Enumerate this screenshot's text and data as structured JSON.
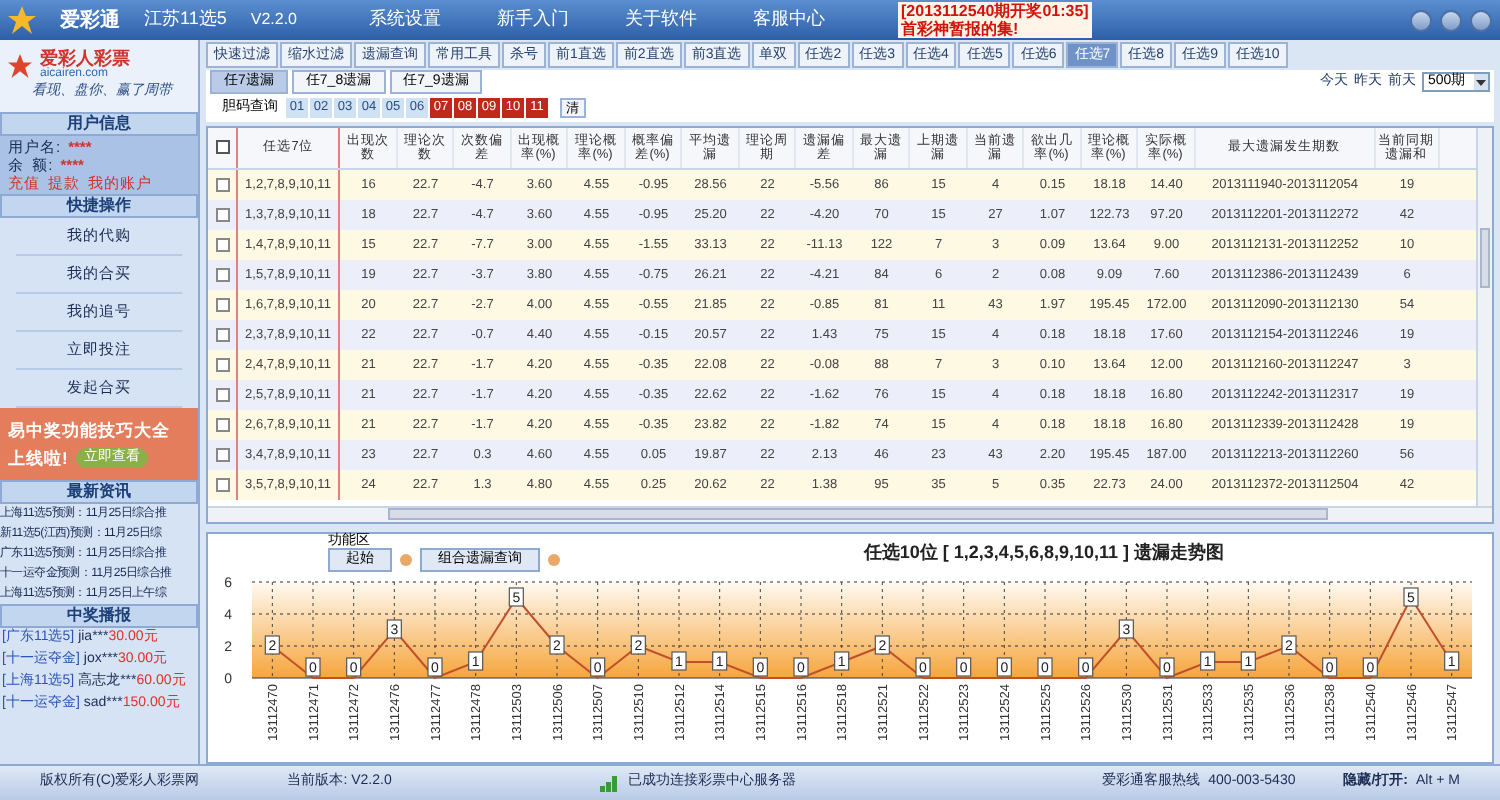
{
  "title_bar": {
    "app_name": "爱彩通",
    "lottery": "江苏11选5",
    "version": "V2.2.0",
    "menu": [
      "系统设置",
      "新手入门",
      "关于软件",
      "客服中心"
    ],
    "notice": [
      "[2013112540期开奖01:35]",
      "首彩神暂报的集!"
    ]
  },
  "sidebar": {
    "logo": {
      "name": "爱彩人彩票",
      "site": "aicairen.com",
      "slogan": "看现、盘你、赢了周带"
    },
    "user": {
      "header": "用户信息",
      "fields": [
        {
          "label": "用户名:",
          "value": "****"
        },
        {
          "label": "余  额:",
          "value": "****"
        }
      ],
      "links": [
        "充值",
        "提款",
        "我的账户"
      ]
    },
    "quick": {
      "header": "快捷操作",
      "items": [
        "我的代购",
        "我的合买",
        "我的追号",
        "立即投注",
        "发起合买"
      ]
    },
    "ad": {
      "line1": "易中奖功能技巧大全",
      "line2": "上线啦!",
      "button": "立即查看"
    },
    "news": {
      "header": "最新资讯",
      "items": [
        "上海11选5预测：11月25日综合推",
        "新11选5(江西)预测：11月25日综",
        "广东11选5预测：11月25日综合推",
        "十一运夺金预测：11月25日综合推",
        "上海11选5预测：11月25日上午综"
      ]
    },
    "wins": {
      "header": "中奖播报",
      "items": [
        {
          "game": "[广东11选5]",
          "user": "jia***",
          "amount": "30.00元"
        },
        {
          "game": "[十一运夺金]",
          "user": "jox***",
          "amount": "30.00元"
        },
        {
          "game": "[上海11选5]",
          "user": "高志龙***",
          "amount": "60.00元"
        },
        {
          "game": "[十一运夺金]",
          "user": "sad***",
          "amount": "150.00元"
        }
      ]
    }
  },
  "tabs": [
    {
      "label": "快速过滤",
      "selected": false
    },
    {
      "label": "缩水过滤",
      "selected": false
    },
    {
      "label": "遗漏查询",
      "selected": false
    },
    {
      "label": "常用工具",
      "selected": false
    },
    {
      "label": "杀号",
      "selected": false
    },
    {
      "label": "前1直选",
      "selected": false
    },
    {
      "label": "前2直选",
      "selected": false
    },
    {
      "label": "前3直选",
      "selected": false
    },
    {
      "label": "单双",
      "selected": false
    },
    {
      "label": "任选2",
      "selected": false
    },
    {
      "label": "任选3",
      "selected": false
    },
    {
      "label": "任选4",
      "selected": false
    },
    {
      "label": "任选5",
      "selected": false
    },
    {
      "label": "任选6",
      "selected": false
    },
    {
      "label": "任选7",
      "selected": true
    },
    {
      "label": "任选8",
      "selected": false
    },
    {
      "label": "任选9",
      "selected": false
    },
    {
      "label": "任选10",
      "selected": false
    }
  ],
  "sub_tabs": [
    {
      "label": "任7遗漏",
      "selected": true
    },
    {
      "label": "任7_8遗漏",
      "selected": false
    },
    {
      "label": "任7_9遗漏",
      "selected": false
    }
  ],
  "day_links": [
    "今天",
    "昨天",
    "前天"
  ],
  "period_select": "500期",
  "filter": {
    "label": "胆码查询",
    "numbers": [
      {
        "label": "01",
        "selected": false
      },
      {
        "label": "02",
        "selected": false
      },
      {
        "label": "03",
        "selected": false
      },
      {
        "label": "04",
        "selected": false
      },
      {
        "label": "05",
        "selected": false
      },
      {
        "label": "06",
        "selected": false
      },
      {
        "label": "07",
        "selected": true
      },
      {
        "label": "08",
        "selected": true
      },
      {
        "label": "09",
        "selected": true
      },
      {
        "label": "10",
        "selected": true
      },
      {
        "label": "11",
        "selected": true
      }
    ],
    "clear": "清"
  },
  "table": {
    "select_all_checked": false,
    "columns": [
      "任选7位",
      "出现次数",
      "理论次数",
      "次数偏差",
      "出现概率(%)",
      "理论概率(%)",
      "概率偏差(%)",
      "平均遗漏",
      "理论周期",
      "遗漏偏差",
      "最大遗漏",
      "上期遗漏",
      "当前遗漏",
      "欲出几率(%)",
      "理论概率(%)",
      "实际概率(%)",
      "最大遗漏发生期数",
      "当前同期遗漏和"
    ],
    "rows": [
      {
        "checked": false,
        "cells": [
          "1,2,7,8,9,10,11",
          "16",
          "22.7",
          "-4.7",
          "3.60",
          "4.55",
          "-0.95",
          "28.56",
          "22",
          "-5.56",
          "86",
          "15",
          "4",
          "0.15",
          "18.18",
          "14.40",
          "2013111940-2013112054",
          "19"
        ]
      },
      {
        "checked": false,
        "cells": [
          "1,3,7,8,9,10,11",
          "18",
          "22.7",
          "-4.7",
          "3.60",
          "4.55",
          "-0.95",
          "25.20",
          "22",
          "-4.20",
          "70",
          "15",
          "27",
          "1.07",
          "122.73",
          "97.20",
          "2013112201-2013112272",
          "42"
        ]
      },
      {
        "checked": false,
        "cells": [
          "1,4,7,8,9,10,11",
          "15",
          "22.7",
          "-7.7",
          "3.00",
          "4.55",
          "-1.55",
          "33.13",
          "22",
          "-11.13",
          "122",
          "7",
          "3",
          "0.09",
          "13.64",
          "9.00",
          "2013112131-2013112252",
          "10"
        ]
      },
      {
        "checked": false,
        "cells": [
          "1,5,7,8,9,10,11",
          "19",
          "22.7",
          "-3.7",
          "3.80",
          "4.55",
          "-0.75",
          "26.21",
          "22",
          "-4.21",
          "84",
          "6",
          "2",
          "0.08",
          "9.09",
          "7.60",
          "2013112386-2013112439",
          "6"
        ]
      },
      {
        "checked": false,
        "cells": [
          "1,6,7,8,9,10,11",
          "20",
          "22.7",
          "-2.7",
          "4.00",
          "4.55",
          "-0.55",
          "21.85",
          "22",
          "-0.85",
          "81",
          "11",
          "43",
          "1.97",
          "195.45",
          "172.00",
          "2013112090-2013112130",
          "54"
        ]
      },
      {
        "checked": false,
        "cells": [
          "2,3,7,8,9,10,11",
          "22",
          "22.7",
          "-0.7",
          "4.40",
          "4.55",
          "-0.15",
          "20.57",
          "22",
          "1.43",
          "75",
          "15",
          "4",
          "0.18",
          "18.18",
          "17.60",
          "2013112154-2013112246",
          "19"
        ]
      },
      {
        "checked": false,
        "cells": [
          "2,4,7,8,9,10,11",
          "21",
          "22.7",
          "-1.7",
          "4.20",
          "4.55",
          "-0.35",
          "22.08",
          "22",
          "-0.08",
          "88",
          "7",
          "3",
          "0.10",
          "13.64",
          "12.00",
          "2013112160-2013112247",
          "3"
        ]
      },
      {
        "checked": false,
        "cells": [
          "2,5,7,8,9,10,11",
          "21",
          "22.7",
          "-1.7",
          "4.20",
          "4.55",
          "-0.35",
          "22.62",
          "22",
          "-1.62",
          "76",
          "15",
          "4",
          "0.18",
          "18.18",
          "16.80",
          "2013112242-2013112317",
          "19"
        ]
      },
      {
        "checked": false,
        "cells": [
          "2,6,7,8,9,10,11",
          "21",
          "22.7",
          "-1.7",
          "4.20",
          "4.55",
          "-0.35",
          "23.82",
          "22",
          "-1.82",
          "74",
          "15",
          "4",
          "0.18",
          "18.18",
          "16.80",
          "2013112339-2013112428",
          "19"
        ]
      },
      {
        "checked": false,
        "cells": [
          "3,4,7,8,9,10,11",
          "23",
          "22.7",
          "0.3",
          "4.60",
          "4.55",
          "0.05",
          "19.87",
          "22",
          "2.13",
          "46",
          "23",
          "43",
          "2.20",
          "195.45",
          "187.00",
          "2013112213-2013112260",
          "56"
        ]
      },
      {
        "checked": false,
        "cells": [
          "3,5,7,8,9,10,11",
          "24",
          "22.7",
          "1.3",
          "4.80",
          "4.55",
          "0.25",
          "20.62",
          "22",
          "1.38",
          "95",
          "35",
          "5",
          "0.35",
          "22.73",
          "24.00",
          "2013112372-2013112504",
          "42"
        ]
      }
    ]
  },
  "chart_panel": {
    "label": "功能区",
    "buttons": [
      "起始",
      "组合遗漏查询"
    ],
    "chart_data": {
      "type": "line",
      "title": "任选10位 [ 1,2,3,4,5,6,8,9,10,11 ] 遗漏走势图",
      "categories": [
        "13112470",
        "13112471",
        "13112472",
        "13112476",
        "13112477",
        "13112478",
        "13112503",
        "13112506",
        "13112507",
        "13112510",
        "13112512",
        "13112514",
        "13112515",
        "13112516",
        "13112518",
        "13112521",
        "13112522",
        "13112523",
        "13112524",
        "13112525",
        "13112526",
        "13112530",
        "13112531",
        "13112533",
        "13112535",
        "13112536",
        "13112538",
        "13112540",
        "13112546",
        "13112547"
      ],
      "grid": true,
      "series": [
        {
          "color": "#c0502a",
          "values": [
            2,
            0,
            0,
            3,
            0,
            1,
            5,
            2,
            0,
            2,
            1,
            1,
            0,
            0,
            1,
            2,
            0,
            0,
            0,
            0,
            0,
            3,
            0,
            1,
            1,
            2,
            0,
            0,
            5,
            1
          ]
        }
      ],
      "ylim": [
        0,
        6
      ],
      "yticks": [
        0,
        2,
        4,
        6
      ],
      "data_labels": true
    }
  },
  "status_bar": {
    "copyright": "版权所有(C)爱彩人彩票网",
    "version": "当前版本: V2.2.0",
    "connection": "已成功连接彩票中心服务器",
    "hotline_label": "爱彩通客服热线",
    "hotline": "400-003-5430",
    "toggle_label": "隐藏/打开:",
    "toggle_keys": "Alt + M"
  }
}
